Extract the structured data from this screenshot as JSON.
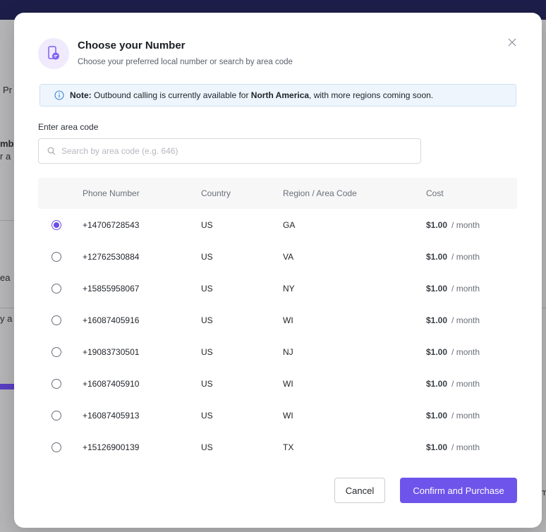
{
  "background": {
    "fragments": [
      "Pr",
      "mb",
      "r a",
      "ea",
      "y a",
      "m"
    ]
  },
  "modal": {
    "title": "Choose your Number",
    "subtitle": "Choose your preferred local number or search by area code",
    "note": {
      "label": "Note:",
      "text_before": " Outbound calling is currently available for ",
      "region": "North America",
      "text_after": ", with more regions coming soon."
    },
    "search": {
      "label": "Enter area code",
      "placeholder": "Search by area code (e.g. 646)",
      "value": ""
    },
    "table": {
      "headers": {
        "phone": "Phone Number",
        "country": "Country",
        "region": "Region / Area Code",
        "cost": "Cost"
      },
      "rows": [
        {
          "phone": "+14706728543",
          "country": "US",
          "region": "GA",
          "amount": "$1.00",
          "period": "/ month",
          "selected": true
        },
        {
          "phone": "+12762530884",
          "country": "US",
          "region": "VA",
          "amount": "$1.00",
          "period": "/ month",
          "selected": false
        },
        {
          "phone": "+15855958067",
          "country": "US",
          "region": "NY",
          "amount": "$1.00",
          "period": "/ month",
          "selected": false
        },
        {
          "phone": "+16087405916",
          "country": "US",
          "region": "WI",
          "amount": "$1.00",
          "period": "/ month",
          "selected": false
        },
        {
          "phone": "+19083730501",
          "country": "US",
          "region": "NJ",
          "amount": "$1.00",
          "period": "/ month",
          "selected": false
        },
        {
          "phone": "+16087405910",
          "country": "US",
          "region": "WI",
          "amount": "$1.00",
          "period": "/ month",
          "selected": false
        },
        {
          "phone": "+16087405913",
          "country": "US",
          "region": "WI",
          "amount": "$1.00",
          "period": "/ month",
          "selected": false
        },
        {
          "phone": "+15126900139",
          "country": "US",
          "region": "TX",
          "amount": "$1.00",
          "period": "/ month",
          "selected": false
        }
      ]
    },
    "buttons": {
      "cancel": "Cancel",
      "confirm": "Confirm and Purchase"
    }
  },
  "colors": {
    "accent": "#6f54eb",
    "radio_selected": "#6b4ee6",
    "note_bg": "#eef5fc",
    "info_icon": "#3b82d6"
  },
  "icons": {
    "header": "phone-message-icon",
    "close": "close-icon",
    "info": "info-icon",
    "search": "search-icon"
  }
}
